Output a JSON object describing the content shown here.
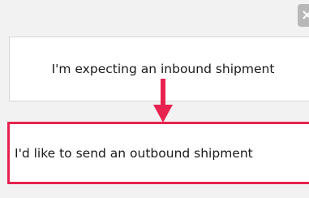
{
  "dialog": {
    "close_label": "×",
    "options": [
      {
        "label": "I'm expecting an inbound shipment"
      },
      {
        "label": "I'd like to send an outbound shipment"
      }
    ]
  },
  "colors": {
    "highlight": "#e8224f",
    "background": "#f2f2f2",
    "close_button": "#b8b8b8"
  },
  "icons": {
    "arrow": "arrow-down-icon"
  }
}
